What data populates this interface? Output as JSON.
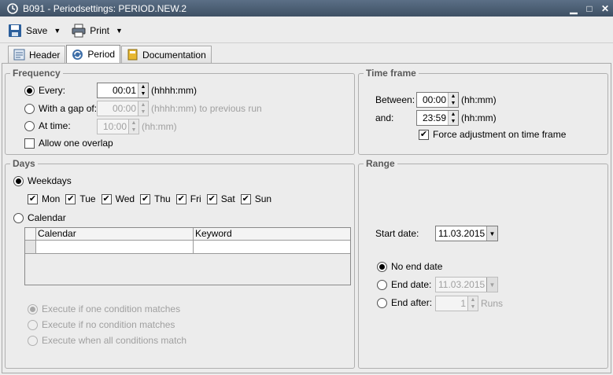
{
  "window": {
    "title": "B091 - Periodsettings: PERIOD.NEW.2",
    "buttons": [
      "▁",
      "□",
      "✕"
    ]
  },
  "toolbar": {
    "save_label": "Save",
    "print_label": "Print"
  },
  "tabs": [
    {
      "label": "Header"
    },
    {
      "label": "Period"
    },
    {
      "label": "Documentation"
    }
  ],
  "frequency": {
    "title": "Frequency",
    "every": {
      "label": "Every:",
      "value": "00:01",
      "unit": "(hhhh:mm)"
    },
    "gap": {
      "label": "With a gap of:",
      "value": "00:00",
      "unit": "(hhhh:mm) to previous run"
    },
    "at_time": {
      "label": "At time:",
      "value": "10:00",
      "unit": "(hh:mm)"
    },
    "allow_overlap": "Allow one overlap"
  },
  "time_frame": {
    "title": "Time frame",
    "between": {
      "label": "Between:",
      "value": "00:00",
      "unit": "(hh:mm)"
    },
    "and": {
      "label": "and:",
      "value": "23:59",
      "unit": "(hh:mm)"
    },
    "force": "Force adjustment on time frame"
  },
  "days": {
    "title": "Days",
    "weekdays_label": "Weekdays",
    "weekdays": [
      "Mon",
      "Tue",
      "Wed",
      "Thu",
      "Fri",
      "Sat",
      "Sun"
    ],
    "calendar_label": "Calendar",
    "columns": [
      "Calendar",
      "Keyword"
    ],
    "conditions": [
      "Execute if one condition matches",
      "Execute if no condition matches",
      "Execute when all conditions match"
    ]
  },
  "range": {
    "title": "Range",
    "start_label": "Start date:",
    "start_value": "11.03.2015",
    "no_end": "No end date",
    "end_date_label": "End date:",
    "end_date_value": "11.03.2015",
    "end_after_label": "End after:",
    "end_after_value": "1",
    "end_after_unit": "Runs"
  }
}
